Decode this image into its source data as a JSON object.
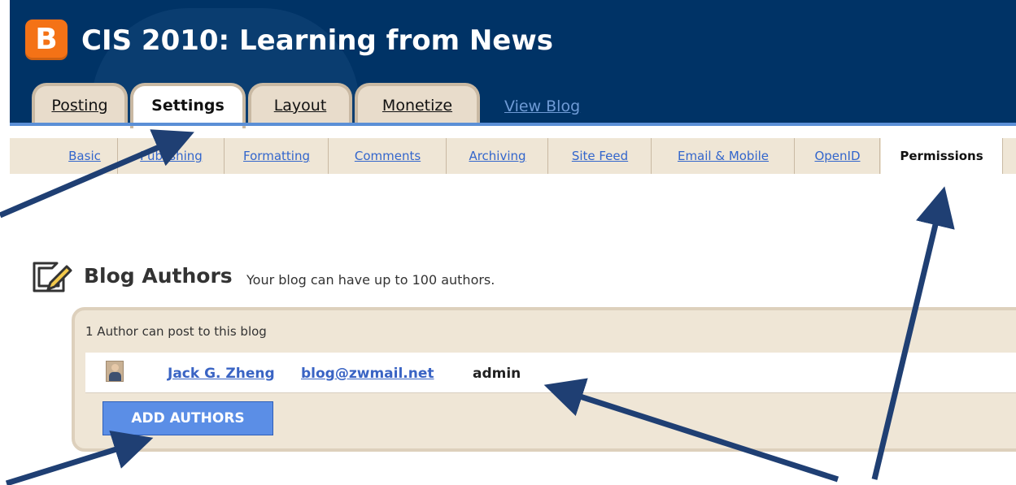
{
  "header": {
    "logo_letter": "B",
    "blog_title": "CIS 2010: Learning from News"
  },
  "tabs": [
    {
      "label": "Posting"
    },
    {
      "label": "Settings"
    },
    {
      "label": "Layout"
    },
    {
      "label": "Monetize"
    }
  ],
  "view_blog": "View Blog",
  "active_tab": "Settings",
  "subtabs": [
    {
      "label": "Basic"
    },
    {
      "label": "Publishing"
    },
    {
      "label": "Formatting"
    },
    {
      "label": "Comments"
    },
    {
      "label": "Archiving"
    },
    {
      "label": "Site Feed"
    },
    {
      "label": "Email & Mobile"
    },
    {
      "label": "OpenID"
    },
    {
      "label": "Permissions"
    }
  ],
  "active_subtab": "Permissions",
  "section": {
    "title": "Blog Authors",
    "subtitle": "Your blog can have up to 100 authors."
  },
  "authors_box": {
    "caption": "1 Author can post to this blog",
    "authors": [
      {
        "name": "Jack G. Zheng",
        "email": "blog@zwmail.net",
        "role": "admin"
      }
    ],
    "add_button": "ADD AUTHORS"
  },
  "colors": {
    "header_bg": "#003366",
    "accent_orange": "#f47216",
    "link_blue": "#3366cc",
    "arrow": "#1f3f73"
  },
  "icons": [
    "blogger-logo-icon",
    "edit-pencil-icon",
    "avatar-icon",
    "arrow-icon"
  ]
}
